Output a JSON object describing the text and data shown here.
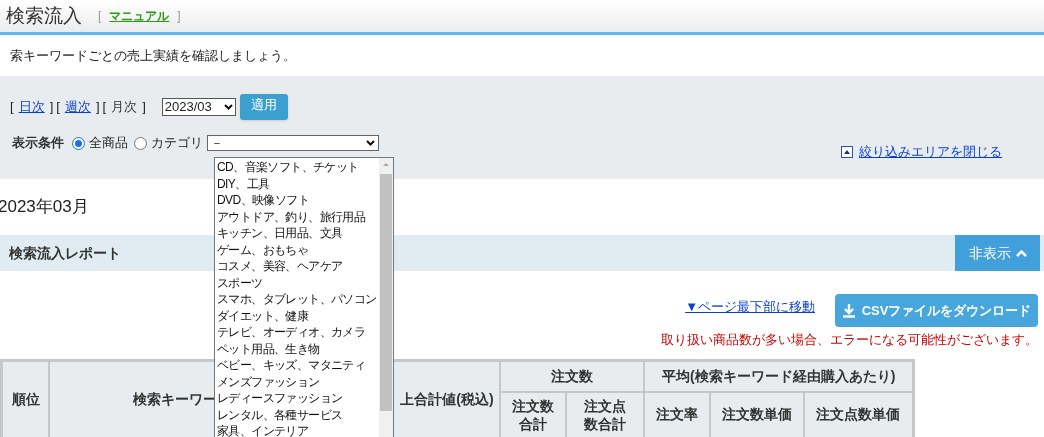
{
  "header": {
    "title": "検索流入",
    "bracket_open": "[",
    "manual_link": "マニュアル",
    "bracket_close": "]"
  },
  "description": "索キーワードごとの売上実績を確認しましょう。",
  "filter": {
    "periods": [
      {
        "open": "[",
        "label": "日次",
        "close": "]",
        "selected": false
      },
      {
        "open": "[",
        "label": "週次",
        "close": "]",
        "selected": false
      },
      {
        "open": "[",
        "label": "月次",
        "close": "]",
        "selected": true
      }
    ],
    "month_select": "2023/03",
    "apply_button": "適用",
    "condition_label": "表示条件",
    "radios": [
      {
        "label": "全商品",
        "selected": true
      },
      {
        "label": "カテゴリ",
        "selected": false
      }
    ],
    "category_select": "－",
    "close_link": "絞り込みエリアを閉じる"
  },
  "category_options": [
    "CD、音楽ソフト、チケット",
    "DIY、工具",
    "DVD、映像ソフト",
    "アウトドア、釣り、旅行用品",
    "キッチン、日用品、文具",
    "ゲーム、おもちゃ",
    "コスメ、美容、ヘアケア",
    "スポーツ",
    "スマホ、タブレット、パソコン",
    "ダイエット、健康",
    "テレビ、オーディオ、カメラ",
    "ペット用品、生き物",
    "ベビー、キッズ、マタニティ",
    "メンズファッション",
    "レディースファッション",
    "レンタル、各種サービス",
    "家具、インテリア"
  ],
  "month_heading": "2023年03月",
  "report": {
    "title": "検索流入レポート",
    "hide_button": "非表示",
    "jump_link": "▼ページ最下部に移動",
    "csv_button": "CSVファイルをダウンロード",
    "warning": "取り扱い商品数が多い場合、エラーになる可能性がございます。"
  },
  "table": {
    "rank": "順位",
    "keyword": "検索キーワー",
    "sales": "上合計値(税込)",
    "orders_group": "注文数",
    "orders_columns": [
      "注文数合計",
      "注文点数合計"
    ],
    "average_group": "平均(検索キーワード経由購入あたり)",
    "average_columns": [
      "注文率",
      "注文数単価",
      "注文点数単価"
    ]
  }
}
